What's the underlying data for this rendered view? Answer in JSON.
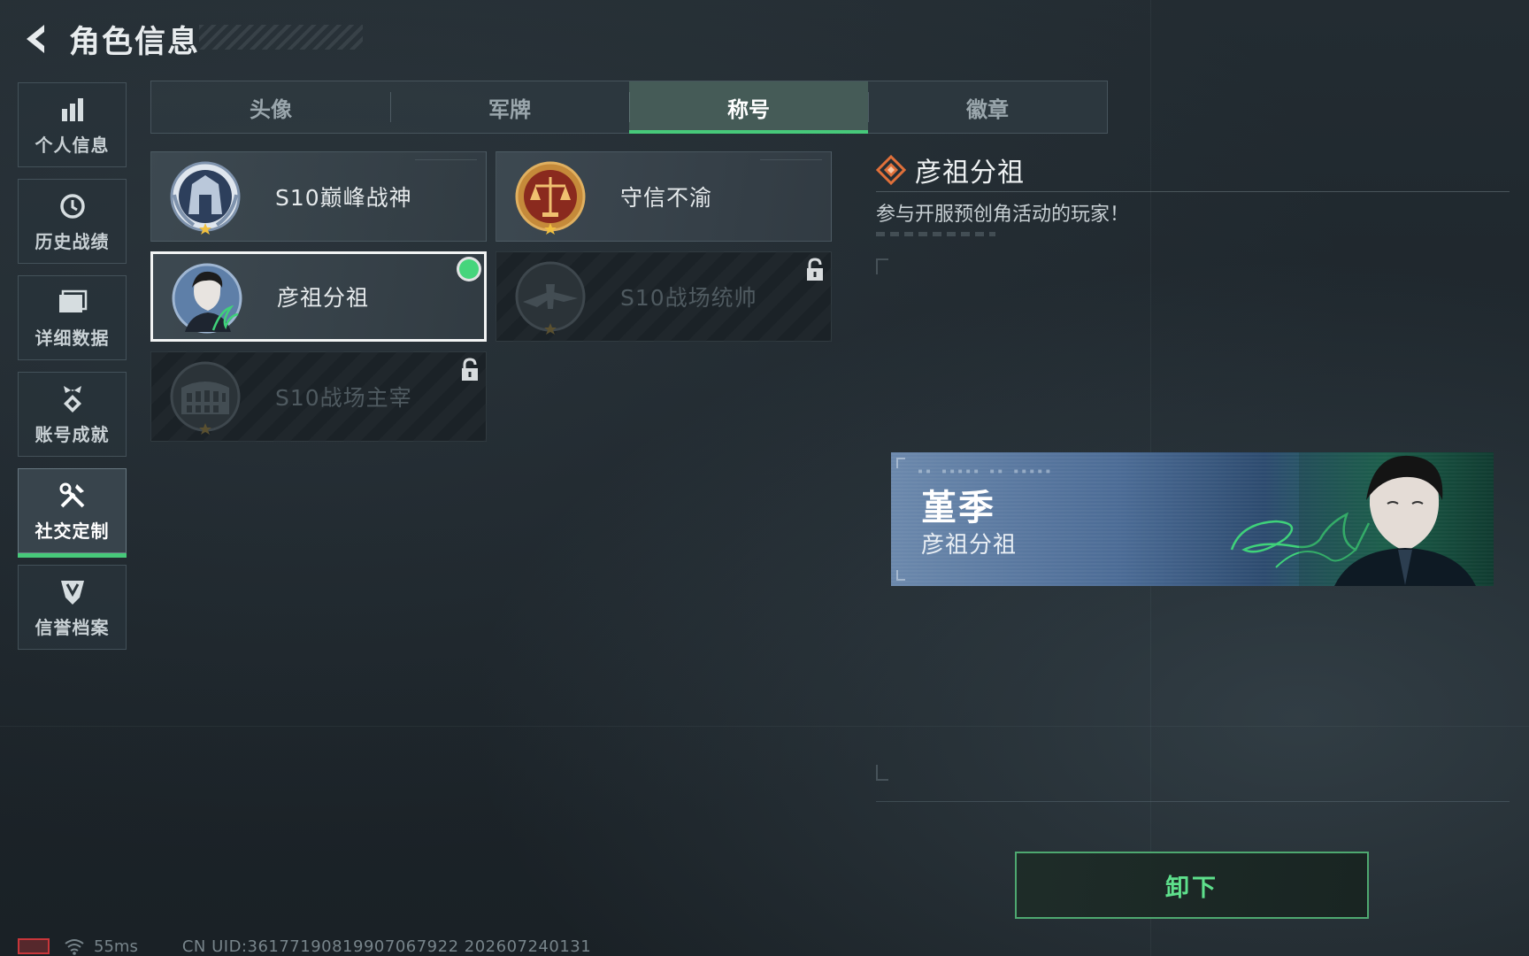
{
  "header": {
    "title": "角色信息"
  },
  "sidebar": {
    "items": [
      {
        "label": "个人信息",
        "icon": "bar-chart-icon",
        "active": false
      },
      {
        "label": "历史战绩",
        "icon": "history-clock-icon",
        "active": false
      },
      {
        "label": "详细数据",
        "icon": "folder-icon",
        "active": false
      },
      {
        "label": "账号成就",
        "icon": "achievement-badge-icon",
        "active": false
      },
      {
        "label": "社交定制",
        "icon": "tools-icon",
        "active": true
      },
      {
        "label": "信誉档案",
        "icon": "credit-shield-icon",
        "active": false
      }
    ]
  },
  "tabs": [
    {
      "label": "头像",
      "active": false
    },
    {
      "label": "军牌",
      "active": false
    },
    {
      "label": "称号",
      "active": true
    },
    {
      "label": "徽章",
      "active": false
    }
  ],
  "titles": [
    {
      "name": "S10巅峰战神",
      "emblem": "laurel-tower-emblem-icon",
      "locked": false,
      "selected": false
    },
    {
      "name": "守信不渝",
      "emblem": "scales-emblem-icon",
      "locked": false,
      "selected": false
    },
    {
      "name": "彦祖分祖",
      "emblem": "portrait-signature-emblem-icon",
      "locked": false,
      "selected": true,
      "equipped": true
    },
    {
      "name": "S10战场统帅",
      "emblem": "aircraft-emblem-icon",
      "locked": true,
      "selected": false
    },
    {
      "name": "S10战场主宰",
      "emblem": "colosseum-emblem-icon",
      "locked": true,
      "selected": false
    }
  ],
  "detail": {
    "title": "彦祖分祖",
    "description": "参与开服预创角活动的玩家！",
    "icon": "diamond-emblem-icon"
  },
  "preview": {
    "player_name": "堇季",
    "title": "彦祖分祖"
  },
  "actions": {
    "unequip_label": "卸下"
  },
  "footer": {
    "ping": "55ms",
    "uid": "CN UID:3617719081990706792​2 202607240131"
  },
  "colors": {
    "accent_green": "#47c97a",
    "detail_icon_orange": "#e0703a",
    "battery_red": "#c8363a"
  }
}
